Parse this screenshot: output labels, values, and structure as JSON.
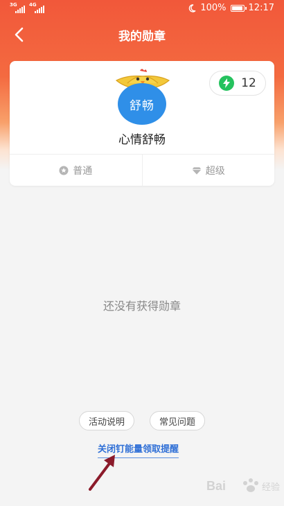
{
  "status_bar": {
    "left_signal_1": "3G",
    "left_signal_2": "4G",
    "battery_percent": "100%",
    "battery_level": 1.0,
    "time": "12:17"
  },
  "nav": {
    "title": "我的勋章",
    "back_icon": "chevron-left-icon"
  },
  "card": {
    "energy_count": "12",
    "medal_text": "舒畅",
    "medal_name": "心情舒畅",
    "tabs": [
      {
        "label": "普通",
        "icon": "star-circle-icon"
      },
      {
        "label": "超级",
        "icon": "diamond-icon"
      }
    ]
  },
  "empty_state": "还没有获得勋章",
  "buttons": {
    "activity_info": "活动说明",
    "faq": "常见问题"
  },
  "close_reminder_link": "关闭钉能量领取提醒",
  "watermark_text": "Bai 经验",
  "colors": {
    "header": "#f1583a",
    "bolt": "#25c25e",
    "medal": "#2f8fe8",
    "link": "#2f6fd6",
    "arrow": "#8b1a2a"
  }
}
